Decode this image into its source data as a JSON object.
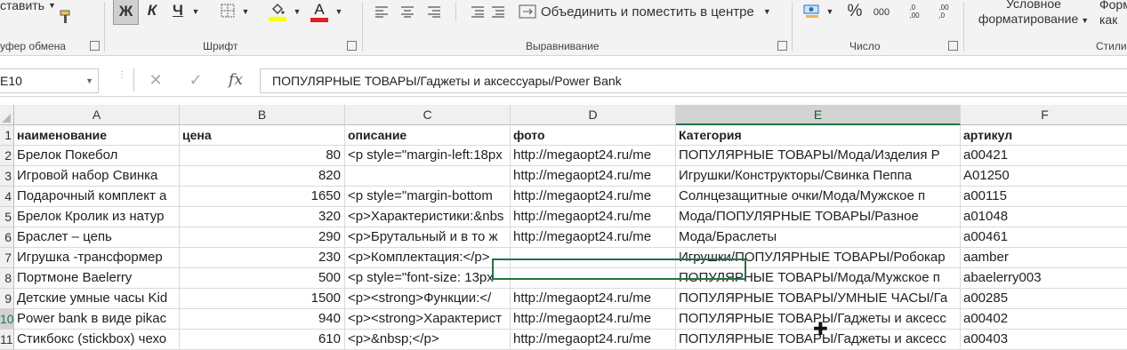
{
  "ribbon": {
    "clipboard": {
      "paste_label": "ставить",
      "group_label": "уфер обмена"
    },
    "font": {
      "bold": "Ж",
      "italic": "К",
      "underline": "Ч",
      "group_label": "Шрифт",
      "fill_color": "#ffff00",
      "font_color": "#e02020"
    },
    "alignment": {
      "merge_label": "Объединить и поместить в центре",
      "group_label": "Выравнивание"
    },
    "number": {
      "percent": "%",
      "thousands": "000",
      "inc_decimal": ",0\n,00",
      "dec_decimal": ",00\n,0",
      "group_label": "Число"
    },
    "styles": {
      "conditional_line1": "Условное",
      "conditional_line2": "форматирование",
      "format_as_line1": "Форм",
      "format_as_line2": "как",
      "group_label": "Стили"
    }
  },
  "formula_bar": {
    "name_box": "E10",
    "fx": "fx",
    "cancel": "✕",
    "enter": "✓",
    "content": "ПОПУЛЯРНЫЕ ТОВАРЫ/Гаджеты и аксессуары/Power Bank"
  },
  "columns": [
    "A",
    "B",
    "C",
    "D",
    "E",
    "F"
  ],
  "rows": [
    {
      "num": "1",
      "A": "наименование",
      "B": "цена",
      "C": "описание",
      "D": "фото",
      "E": "Категория",
      "F": "артикул"
    },
    {
      "num": "2",
      "A": "Брелок Покебол",
      "B": "80",
      "C": "<p style=\"margin-left:18px",
      "D": "http://megaopt24.ru/me",
      "E": "ПОПУЛЯРНЫЕ ТОВАРЫ/Мода/Изделия Р",
      "F": "a00421"
    },
    {
      "num": "3",
      "A": "Игровой набор Свинка",
      "B": "820",
      "C": "",
      "D": "http://megaopt24.ru/me",
      "E": "Игрушки/Конструкторы/Свинка Пеппа",
      "F": "A01250"
    },
    {
      "num": "4",
      "A": "Подарочный комплект а",
      "B": "1650",
      "C": "<p style=\"margin-bottom",
      "D": "http://megaopt24.ru/me",
      "E": "Солнцезащитные очки/Мода/Мужское п",
      "F": "a00115"
    },
    {
      "num": "5",
      "A": "Брелок Кролик из натур",
      "B": "320",
      "C": "<p>Характеристики:&nbs",
      "D": "http://megaopt24.ru/me",
      "E": "Мода/ПОПУЛЯРНЫЕ ТОВАРЫ/Разное",
      "F": "a01048"
    },
    {
      "num": "6",
      "A": "Браслет – цепь",
      "B": "290",
      "C": "<p>Брутальный и в то ж",
      "D": "http://megaopt24.ru/me",
      "E": "Мода/Браслеты",
      "F": "a00461"
    },
    {
      "num": "7",
      "A": "Игрушка -трансформер",
      "B": "230",
      "C": "<p>Комплектация:</p>",
      "D": "",
      "E": "Игрушки/ПОПУЛЯРНЫЕ ТОВАРЫ/Робокар",
      "F": "aamber"
    },
    {
      "num": "8",
      "A": "Портмоне Baelerry",
      "B": "500",
      "C": "<p style=\"font-size: 13px",
      "D": "",
      "E": "ПОПУЛЯРНЫЕ ТОВАРЫ/Мода/Мужское п",
      "F": "abaelerry003"
    },
    {
      "num": "9",
      "A": "Детские умные часы Kid",
      "B": "1500",
      "C": "<p><strong>Функции:</",
      "D": "http://megaopt24.ru/me",
      "E": "ПОПУЛЯРНЫЕ ТОВАРЫ/УМНЫЕ ЧАСЫ/Га",
      "F": "a00285"
    },
    {
      "num": "10",
      "A": "Power bank в виде pikac",
      "B": "940",
      "C": "<p><strong>Характерист",
      "D": "http://megaopt24.ru/me",
      "E": "ПОПУЛЯРНЫЕ ТОВАРЫ/Гаджеты и аксесс",
      "F": "a00402"
    },
    {
      "num": "11",
      "A": "Стикбокс (stickbox) чехо",
      "B": "610",
      "C": "<p>&nbsp;</p>",
      "D": "http://megaopt24.ru/me",
      "E": "ПОПУЛЯРНЫЕ ТОВАРЫ/Гаджеты и аксесс",
      "F": "a00403"
    }
  ]
}
